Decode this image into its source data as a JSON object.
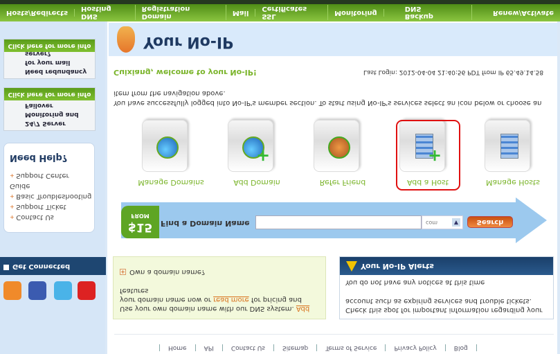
{
  "top_links": [
    "Home",
    "API",
    "Contact Us",
    "Sitemap",
    "Terms of Service",
    "Privacy Policy",
    "Blog"
  ],
  "domain_box": {
    "line1": "Use your own domain name with our DNS system.",
    "add": "Add",
    "line2a": "your domain name now or",
    "read_more": "read more",
    "line2b": "for pricing and",
    "line3": "features",
    "own_domain": "Own a domain name?"
  },
  "alerts": {
    "title": "Your No-IP Alerts",
    "notice": "You do not have any notices at this time",
    "desc": "Check this spot for important information regarding your account such as expiring services and trouble tickets."
  },
  "sidebar": {
    "get_connected": "Get Connected",
    "social": [
      "YouTube",
      "Twitter",
      "Facebook",
      "RSS"
    ],
    "help": {
      "title": "Need Help?",
      "items": [
        "Support Center",
        "Basic Troubleshooting Guide",
        "Support Ticket",
        "Contact Us"
      ]
    },
    "ads": [
      {
        "text": "24/7 Server Monitoring and Failover",
        "cta": "Click here for more info"
      },
      {
        "text": "Need redundancy for your mail server?",
        "cta": "Click here for more info"
      }
    ]
  },
  "search": {
    "from": "FROM",
    "price": "$15",
    "label": "Find a Domain Name",
    "value": "",
    "tld": "com",
    "button": "Search"
  },
  "tiles": [
    {
      "label": "Manage Domains",
      "icon": "globe-manage-icon"
    },
    {
      "label": "Add Domain",
      "icon": "globe-add-icon"
    },
    {
      "label": "Refer Friend",
      "icon": "refer-friend-icon"
    },
    {
      "label": "Add a Host",
      "icon": "server-add-icon"
    },
    {
      "label": "Manage Hosts",
      "icon": "server-manage-icon"
    }
  ],
  "highlight_color": "#e01010",
  "welcome": "Cuixiang, welcome to your No-IP!",
  "last_login": "Last Login: 2012-04-04 21:40:56 PDT from IP 65.49.14.58",
  "intro": "You have successfully logged into No-IP's member section. To start using No-IP's services select an icon below or choose an item from the navigation above.",
  "header_title": "Your No-IP",
  "bottom_nav": [
    "Hosts/Redirects",
    "DNS Hosting",
    "Domain Registration",
    "Mail",
    "SSL Certificates",
    "Monitoring",
    "Backup DNS",
    "Renew/Activate"
  ]
}
